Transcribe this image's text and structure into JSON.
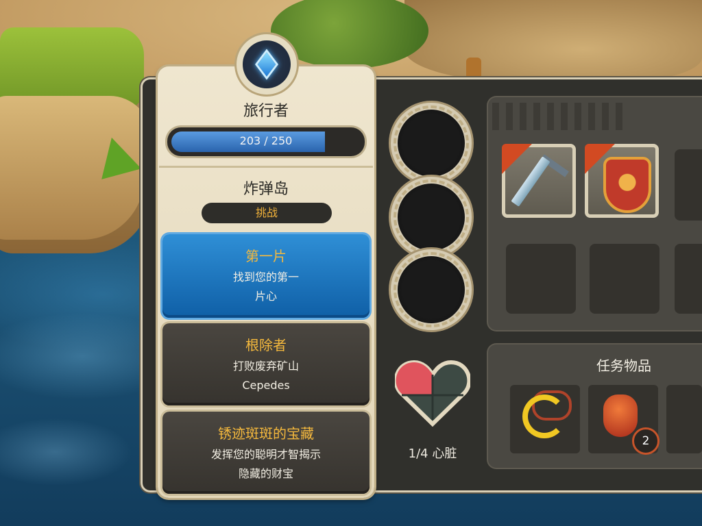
{
  "player": {
    "name": "旅行者",
    "xp_text": "203 / 250",
    "xp_fraction": 0.812
  },
  "island": {
    "name": "炸弹岛",
    "challenge_label": "挑战"
  },
  "quests": [
    {
      "title": "第一片",
      "desc_line1": "找到您的第一",
      "desc_line2": "片心",
      "state": "active"
    },
    {
      "title": "根除者",
      "desc_line1": "打败废弃矿山",
      "desc_line2": "Cepedes",
      "state": "normal"
    },
    {
      "title": "锈迹斑斑的宝藏",
      "desc_line1": "发挥您的聪明才智揭示",
      "desc_line2": "隐藏的财宝",
      "state": "normal"
    }
  ],
  "heart": {
    "label": "1/4 心脏",
    "pieces_collected": 1,
    "pieces_total": 4
  },
  "inventory": {
    "items": [
      {
        "icon": "sword-icon"
      },
      {
        "icon": "shield-icon"
      }
    ]
  },
  "quest_items": {
    "title": "任务物品",
    "items": [
      {
        "icon": "amulet-icon"
      },
      {
        "icon": "ruby-icon",
        "count": "2"
      }
    ]
  },
  "colors": {
    "accent_gold": "#f5b93d",
    "active_blue": "#0f5fa6",
    "heart_red": "#e0545d"
  }
}
